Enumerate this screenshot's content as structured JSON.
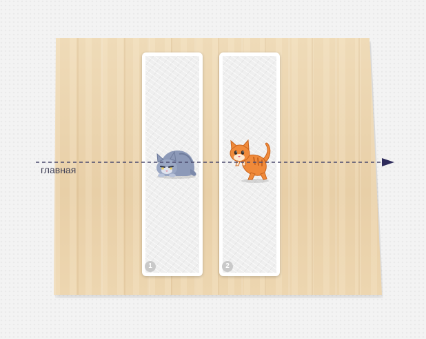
{
  "axis": {
    "label": "главная"
  },
  "panels": [
    {
      "number": "1",
      "character": "gray-cat"
    },
    {
      "number": "2",
      "character": "orange-cat"
    }
  ],
  "colors": {
    "axis_line": "#4b4a6e",
    "board": "#ead3ae",
    "panel_background": "#efefef",
    "badge": "#c9c9c9",
    "gray_cat": "#8c99b8",
    "orange_cat": "#f08a3a"
  }
}
